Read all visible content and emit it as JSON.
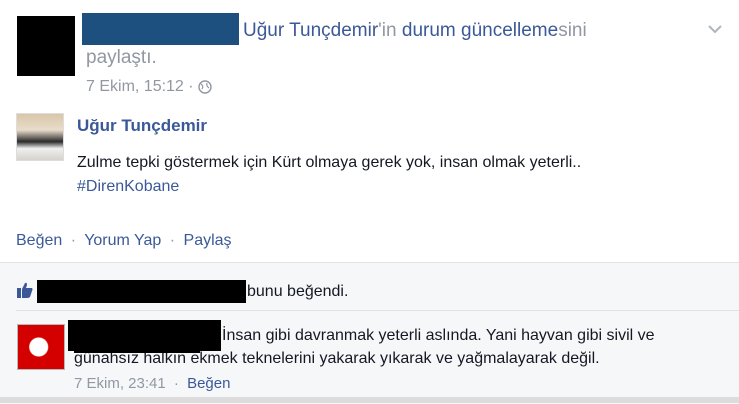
{
  "header": {
    "mentioned_name": "Uğur Tunçdemir",
    "mentioned_suffix": "'in",
    "link_text": "durum güncelleme",
    "link_suffix": "sini",
    "action_word": "paylaştı.",
    "timestamp": "7 Ekim, 15:12 ·",
    "privacy_icon": "globe-icon",
    "menu_icon": "chevron-down-icon"
  },
  "shared_post": {
    "author": "Uğur Tunçdemir",
    "text": "Zulme tepki göstermek için Kürt olmaya gerek yok, insan olmak yeterli..",
    "hashtag": "#DirenKobane"
  },
  "actions": {
    "like": "Beğen",
    "comment": "Yorum Yap",
    "share": "Paylaş",
    "sep": "·"
  },
  "likes": {
    "icon": "thumbs-up-icon",
    "text": "bunu beğendi."
  },
  "comment": {
    "line1": "İnsan gibi davranmak yeterli aslında. Yani hayvan gibi sivil ve",
    "line2": "günahsız halkın ekmek teknelerini yakarak yıkarak ve yağmalayarak değil.",
    "time": "7 Ekim, 23:41",
    "sep": "·",
    "like": "Beğen"
  },
  "colors": {
    "link_blue": "#3b5998",
    "gray_text": "#9197a3",
    "redaction_bar": "#1d4f7f"
  }
}
